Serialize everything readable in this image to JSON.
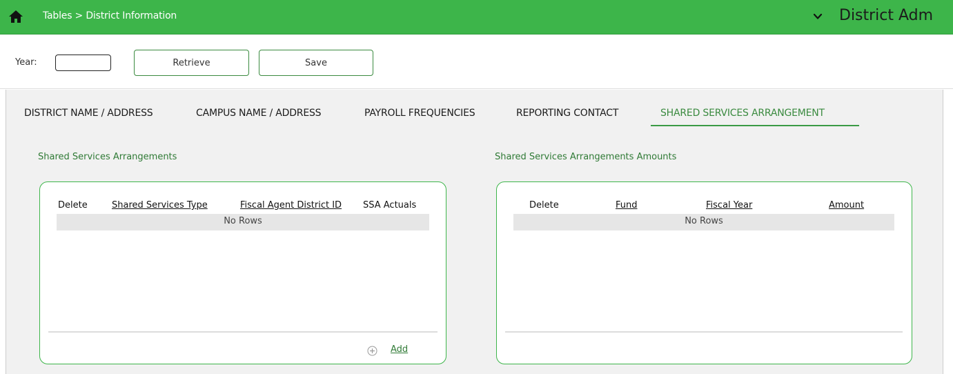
{
  "header": {
    "breadcrumb": "Tables > District Information",
    "app_title": "District Adm",
    "icons": {
      "home": "home-icon",
      "menu": "chevron-down-icon"
    }
  },
  "toolbar": {
    "year_label": "Year:",
    "year_value": "",
    "retrieve_label": "Retrieve",
    "save_label": "Save"
  },
  "tabs": [
    {
      "label": "DISTRICT NAME / ADDRESS",
      "active": false
    },
    {
      "label": "CAMPUS NAME / ADDRESS",
      "active": false
    },
    {
      "label": "PAYROLL FREQUENCIES",
      "active": false
    },
    {
      "label": "REPORTING CONTACT",
      "active": false
    },
    {
      "label": "SHARED SERVICES ARRANGEMENT",
      "active": true
    }
  ],
  "left_panel": {
    "title": "Shared Services Arrangements",
    "columns": [
      "Delete",
      "Shared Services Type",
      "Fiscal Agent District ID",
      "SSA Actuals"
    ],
    "empty_text": "No Rows",
    "add_label": "Add"
  },
  "right_panel": {
    "title": "Shared Services Arrangements Amounts",
    "columns": [
      "Delete",
      "Fund",
      "Fiscal Year",
      "Amount"
    ],
    "empty_text": "No Rows"
  },
  "colors": {
    "brand_green": "#3db54a",
    "accent_green": "#2f7a35"
  }
}
